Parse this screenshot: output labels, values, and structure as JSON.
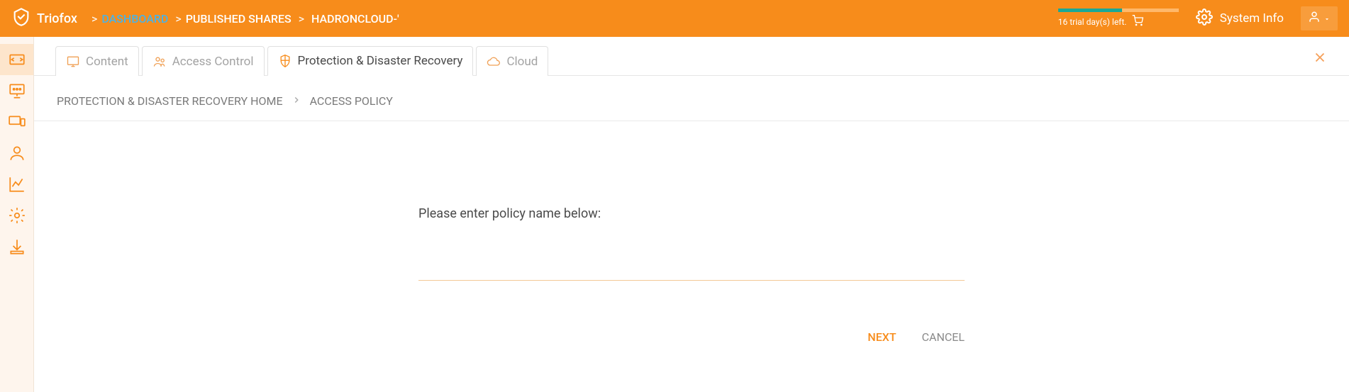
{
  "header": {
    "brand": "Triofox",
    "breadcrumb": [
      {
        "label": "DASHBOARD",
        "link": true
      },
      {
        "label": "PUBLISHED SHARES",
        "link": false
      },
      {
        "label": "HADRONCLOUD-'",
        "link": false
      }
    ],
    "trial_text": "16 trial day(s) left.",
    "system_info": "System Info"
  },
  "tabs": [
    {
      "label": "Content",
      "icon": "monitor-icon",
      "active": false
    },
    {
      "label": "Access Control",
      "icon": "users-icon",
      "active": false
    },
    {
      "label": "Protection & Disaster Recovery",
      "icon": "shield-icon",
      "active": true
    },
    {
      "label": "Cloud",
      "icon": "cloud-icon",
      "active": false
    }
  ],
  "sub_breadcrumb": {
    "home": "PROTECTION & DISASTER RECOVERY HOME",
    "current": "ACCESS POLICY"
  },
  "form": {
    "prompt": "Please enter policy name below:",
    "value": "",
    "next": "NEXT",
    "cancel": "CANCEL"
  }
}
